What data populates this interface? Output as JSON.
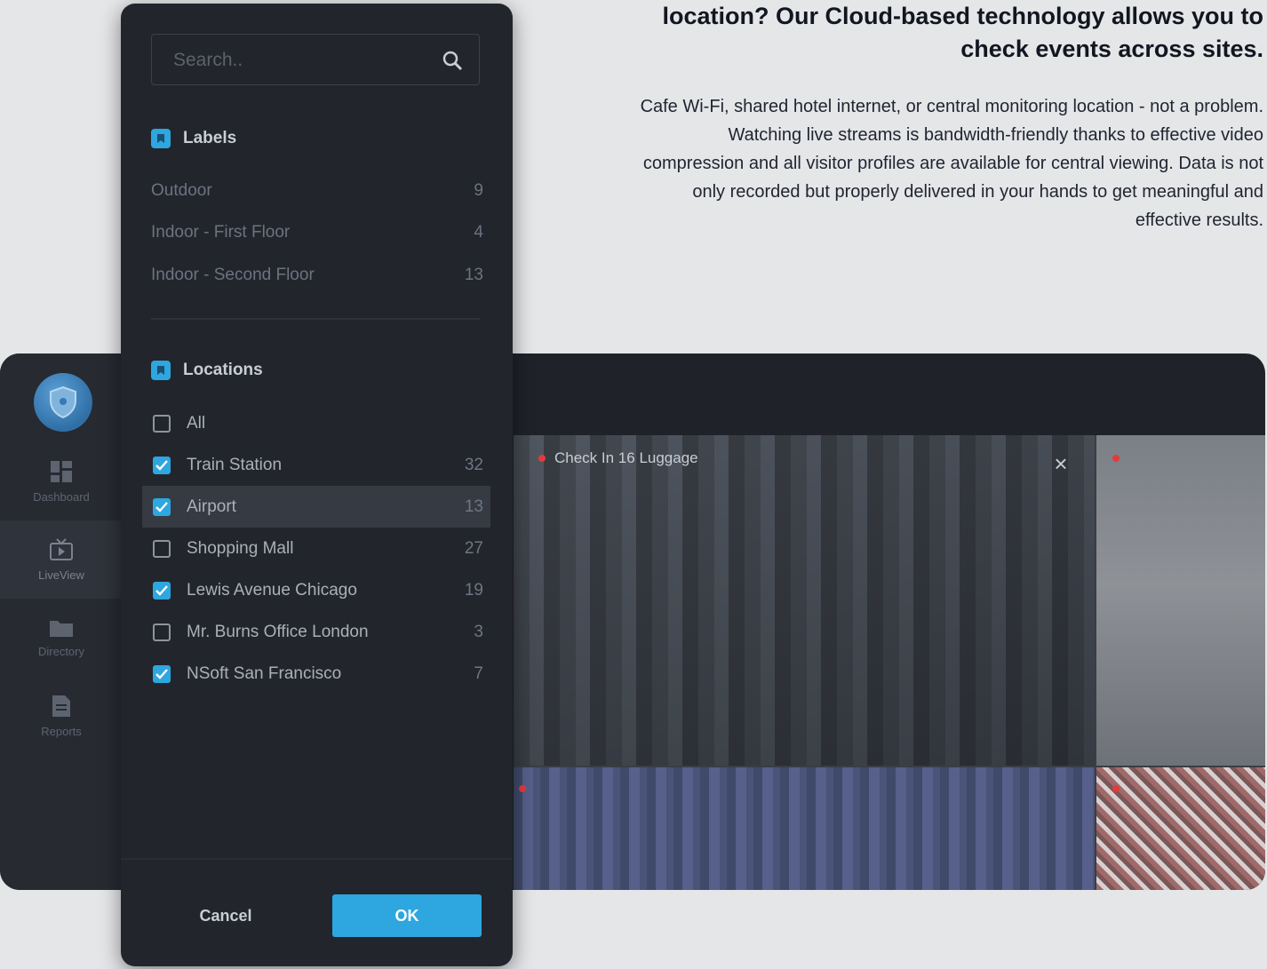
{
  "hero": {
    "title": "location? Our Cloud-based technology allows you to check events across sites.",
    "text": "Cafe Wi-Fi, shared hotel internet, or central monitoring location - not a problem. Watching live streams is bandwidth-friendly thanks to effective video compression and all visitor profiles are available for central viewing. Data is not only recorded but properly delivered in your hands to get meaningful and effective results."
  },
  "nav": {
    "items": [
      {
        "label": "Dashboard",
        "icon": "dashboard-icon"
      },
      {
        "label": "LiveView",
        "icon": "liveview-icon",
        "active": true
      },
      {
        "label": "Directory",
        "icon": "folder-icon"
      },
      {
        "label": "Reports",
        "icon": "report-icon"
      }
    ]
  },
  "video": {
    "main_caption": "Check In 16 Luggage",
    "close_label": "×"
  },
  "panel": {
    "search_placeholder": "Search..",
    "labels_title": "Labels",
    "labels": [
      {
        "name": "Outdoor",
        "count": "9"
      },
      {
        "name": "Indoor - First Floor",
        "count": "4"
      },
      {
        "name": "Indoor - Second Floor",
        "count": "13"
      }
    ],
    "locations_title": "Locations",
    "locations": [
      {
        "name": "All",
        "count": "",
        "checked": false
      },
      {
        "name": "Train Station",
        "count": "32",
        "checked": true
      },
      {
        "name": "Airport",
        "count": "13",
        "checked": true,
        "highlight": true
      },
      {
        "name": "Shopping Mall",
        "count": "27",
        "checked": false
      },
      {
        "name": "Lewis Avenue Chicago",
        "count": "19",
        "checked": true
      },
      {
        "name": "Mr. Burns Office London",
        "count": "3",
        "checked": false
      },
      {
        "name": "NSoft San Francisco",
        "count": "7",
        "checked": true
      }
    ],
    "cancel_label": "Cancel",
    "ok_label": "OK"
  },
  "colors": {
    "accent": "#2ea6df",
    "panel_bg": "#22252c",
    "app_bg": "#1f2228",
    "page_bg": "#e5e6e8",
    "recording": "#e23b3b"
  }
}
